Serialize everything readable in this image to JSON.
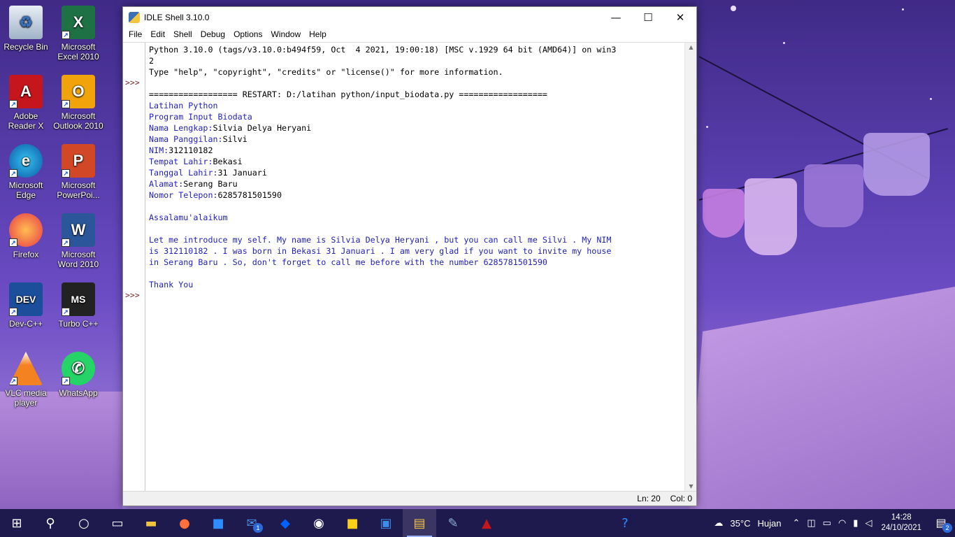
{
  "desktop": {
    "icons": [
      {
        "label": "Recycle Bin",
        "icon": "recycle-bin-icon"
      },
      {
        "label": "Microsoft Excel 2010",
        "icon": "excel-icon"
      },
      {
        "label": "Adobe Reader X",
        "icon": "adobe-reader-icon"
      },
      {
        "label": "Microsoft Outlook 2010",
        "icon": "outlook-icon"
      },
      {
        "label": "Microsoft Edge",
        "icon": "edge-icon"
      },
      {
        "label": "Microsoft PowerPoi...",
        "icon": "powerpoint-icon"
      },
      {
        "label": "Firefox",
        "icon": "firefox-icon"
      },
      {
        "label": "Microsoft Word 2010",
        "icon": "word-icon"
      },
      {
        "label": "Dev-C++",
        "icon": "devcpp-icon"
      },
      {
        "label": "Turbo C++",
        "icon": "turbo-cpp-icon"
      },
      {
        "label": "VLC media player",
        "icon": "vlc-icon"
      },
      {
        "label": "WhatsApp",
        "icon": "whatsapp-icon"
      }
    ]
  },
  "window": {
    "title": "IDLE Shell 3.10.0",
    "controls": {
      "minimize": "—",
      "maximize": "☐",
      "close": "✕"
    },
    "menu": [
      "File",
      "Edit",
      "Shell",
      "Debug",
      "Options",
      "Window",
      "Help"
    ],
    "prompts": [
      ">>>",
      ">>>"
    ],
    "shell_lines": [
      {
        "text": "Python 3.10.0 (tags/v3.10.0:b494f59, Oct  4 2021, 19:00:18) [MSC v.1929 64 bit (AMD64)] on win3",
        "style": "black"
      },
      {
        "text": "2",
        "style": "black"
      },
      {
        "text": "Type \"help\", \"copyright\", \"credits\" or \"license()\" for more information.",
        "style": "black"
      },
      {
        "text": "",
        "style": "black"
      },
      {
        "text": "================== RESTART: D:/latihan python/input_biodata.py ==================",
        "style": "black"
      },
      {
        "text": "Latihan Python",
        "style": "blue"
      },
      {
        "text": "Program Input Biodata",
        "style": "blue"
      },
      {
        "prompt": "Nama Lengkap:",
        "value": "Silvia Delya Heryani"
      },
      {
        "prompt": "Nama Panggilan:",
        "value": "Silvi"
      },
      {
        "prompt": "NIM:",
        "value": "312110182"
      },
      {
        "prompt": "Tempat Lahir:",
        "value": "Bekasi"
      },
      {
        "prompt": "Tanggal Lahir:",
        "value": "31 Januari"
      },
      {
        "prompt": "Alamat:",
        "value": "Serang Baru"
      },
      {
        "prompt": "Nomor Telepon:",
        "value": "6285781501590"
      },
      {
        "text": "",
        "style": "blue"
      },
      {
        "text": "Assalamu'alaikum",
        "style": "blue"
      },
      {
        "text": "",
        "style": "blue"
      },
      {
        "text": "Let me introduce my self. My name is Silvia Delya Heryani , but you can call me Silvi . My NIM",
        "style": "blue"
      },
      {
        "text": "is 312110182 . I was born in Bekasi 31 Januari . I am very glad if you want to invite my house",
        "style": "blue"
      },
      {
        "text": "in Serang Baru . So, don't forget to call me before with the number 6285781501590",
        "style": "blue"
      },
      {
        "text": "",
        "style": "blue"
      },
      {
        "text": "Thank You",
        "style": "blue"
      }
    ],
    "status": {
      "line": "Ln: 20",
      "col": "Col: 0"
    }
  },
  "taskbar": {
    "items": [
      {
        "icon": "windows-start-icon",
        "glyph": "⊞"
      },
      {
        "icon": "search-icon",
        "glyph": "⚲"
      },
      {
        "icon": "cortana-icon",
        "glyph": "○"
      },
      {
        "icon": "task-view-icon",
        "glyph": "▭"
      },
      {
        "icon": "file-explorer-icon",
        "glyph": "▬"
      },
      {
        "icon": "firefox-icon",
        "glyph": "●"
      },
      {
        "icon": "zoom-icon",
        "glyph": "■"
      },
      {
        "icon": "mail-icon",
        "glyph": "✉",
        "badge": "1"
      },
      {
        "icon": "dropbox-icon",
        "glyph": "◆"
      },
      {
        "icon": "github-icon",
        "glyph": "◉"
      },
      {
        "icon": "sticky-notes-icon",
        "glyph": "■"
      },
      {
        "icon": "photos-icon",
        "glyph": "▣"
      },
      {
        "icon": "python-idle-icon",
        "glyph": "▤",
        "active": true
      },
      {
        "icon": "paint-icon",
        "glyph": "✎"
      },
      {
        "icon": "adobe-reader-icon",
        "glyph": "▲"
      },
      {
        "icon": "help-icon",
        "glyph": "?"
      }
    ],
    "weather": {
      "temp": "35°C",
      "condition": "Hujan"
    },
    "tray_icons": [
      "chevron-up-icon",
      "meet-now-icon",
      "display-icon",
      "wifi-icon",
      "battery-icon",
      "volume-icon"
    ],
    "time": "14:28",
    "date": "24/10/2021",
    "notification_count": "2",
    "colors": {
      "bg": "#1f1a4d",
      "accent": "#9fb4ff"
    }
  }
}
